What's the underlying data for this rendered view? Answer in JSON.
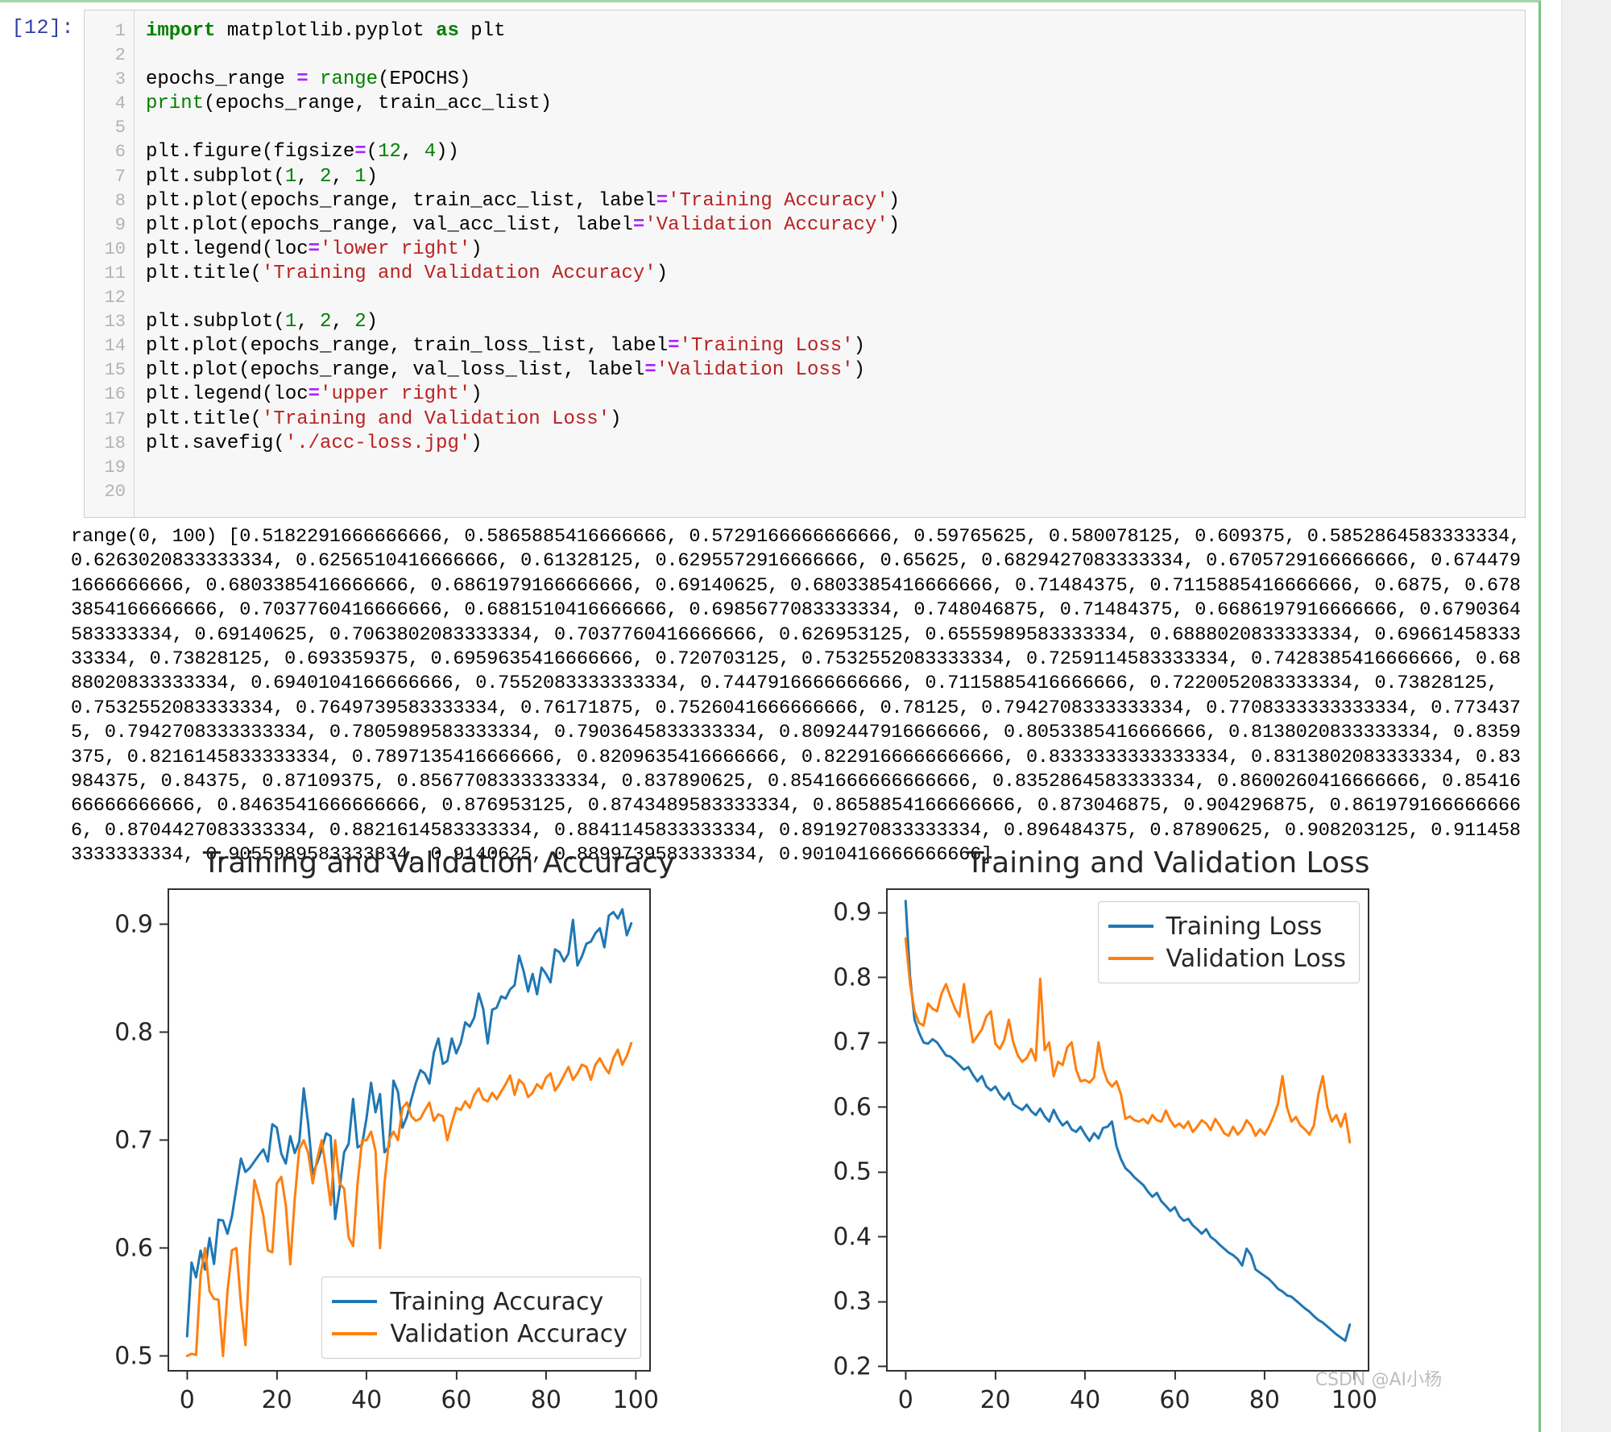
{
  "cell": {
    "prompt": "[12]:",
    "line_numbers": [
      "1",
      "2",
      "3",
      "4",
      "5",
      "6",
      "7",
      "8",
      "9",
      "10",
      "11",
      "12",
      "13",
      "14",
      "15",
      "16",
      "17",
      "18",
      "19",
      "20"
    ],
    "code_lines": [
      "import matplotlib.pyplot as plt",
      "",
      "epochs_range = range(EPOCHS)",
      "print(epochs_range, train_acc_list)",
      "",
      "plt.figure(figsize=(12, 4))",
      "plt.subplot(1, 2, 1)",
      "plt.plot(epochs_range, train_acc_list, label='Training Accuracy')",
      "plt.plot(epochs_range, val_acc_list, label='Validation Accuracy')",
      "plt.legend(loc='lower right')",
      "plt.title('Training and Validation Accuracy')",
      "",
      "plt.subplot(1, 2, 2)",
      "plt.plot(epochs_range, train_loss_list, label='Training Loss')",
      "plt.plot(epochs_range, val_loss_list, label='Validation Loss')",
      "plt.legend(loc='upper right')",
      "plt.title('Training and Validation Loss')",
      "plt.savefig('./acc-loss.jpg')",
      "",
      ""
    ]
  },
  "output": {
    "stdout": "range(0, 100) [0.5182291666666666, 0.5865885416666666, 0.5729166666666666, 0.59765625, 0.580078125, 0.609375, 0.5852864583333334, 0.6263020833333334, 0.6256510416666666, 0.61328125, 0.6295572916666666, 0.65625, 0.6829427083333334, 0.6705729166666666, 0.6744791666666666, 0.6803385416666666, 0.6861979166666666, 0.69140625, 0.6803385416666666, 0.71484375, 0.7115885416666666, 0.6875, 0.6783854166666666, 0.7037760416666666, 0.6881510416666666, 0.6985677083333334, 0.748046875, 0.71484375, 0.6686197916666666, 0.6790364583333334, 0.69140625, 0.7063802083333334, 0.7037760416666666, 0.626953125, 0.6555989583333334, 0.6888020833333334, 0.6966145833333334, 0.73828125, 0.693359375, 0.6959635416666666, 0.720703125, 0.7532552083333334, 0.7259114583333334, 0.7428385416666666, 0.6888020833333334, 0.6940104166666666, 0.7552083333333334, 0.7447916666666666, 0.7115885416666666, 0.7220052083333334, 0.73828125, 0.7532552083333334, 0.7649739583333334, 0.76171875, 0.7526041666666666, 0.78125, 0.7942708333333334, 0.7708333333333334, 0.7734375, 0.7942708333333334, 0.7805989583333334, 0.7903645833333334, 0.8092447916666666, 0.8053385416666666, 0.8138020833333334, 0.8359375, 0.8216145833333334, 0.7897135416666666, 0.8209635416666666, 0.8229166666666666, 0.8333333333333334, 0.8313802083333334, 0.83984375, 0.84375, 0.87109375, 0.8567708333333334, 0.837890625, 0.8541666666666666, 0.8352864583333334, 0.8600260416666666, 0.8541666666666666, 0.8463541666666666, 0.876953125, 0.8743489583333334, 0.8658854166666666, 0.873046875, 0.904296875, 0.8619791666666666, 0.8704427083333334, 0.8821614583333334, 0.8841145833333334, 0.8919270833333334, 0.896484375, 0.87890625, 0.908203125, 0.9114583333333334, 0.9055989583333334, 0.9140625, 0.8899739583333334, 0.9010416666666666]"
  },
  "watermark": "CSDN @AI小杨",
  "chart_data": [
    {
      "type": "line",
      "title": "Training and Validation Accuracy",
      "xlabel": "",
      "ylabel": "",
      "xlim": [
        -4,
        103
      ],
      "ylim": [
        0.487,
        0.932
      ],
      "xticks": [
        0,
        20,
        40,
        60,
        80,
        100
      ],
      "yticks": [
        0.5,
        0.6,
        0.7,
        0.8,
        0.9
      ],
      "grid": false,
      "legend_position": "lower right",
      "colors": {
        "training": "#1f77b4",
        "validation": "#ff7f0e"
      },
      "series": [
        {
          "name": "Training Accuracy",
          "color": "#1f77b4",
          "values": [
            0.5182291666666666,
            0.5865885416666666,
            0.5729166666666666,
            0.59765625,
            0.580078125,
            0.609375,
            0.5852864583333334,
            0.6263020833333334,
            0.6256510416666666,
            0.61328125,
            0.6295572916666666,
            0.65625,
            0.6829427083333334,
            0.6705729166666666,
            0.6744791666666666,
            0.6803385416666666,
            0.6861979166666666,
            0.69140625,
            0.6803385416666666,
            0.71484375,
            0.7115885416666666,
            0.6875,
            0.6783854166666666,
            0.7037760416666666,
            0.6881510416666666,
            0.6985677083333334,
            0.748046875,
            0.71484375,
            0.6686197916666666,
            0.6790364583333334,
            0.69140625,
            0.7063802083333334,
            0.7037760416666666,
            0.626953125,
            0.6555989583333334,
            0.6888020833333334,
            0.6966145833333334,
            0.73828125,
            0.693359375,
            0.6959635416666666,
            0.720703125,
            0.7532552083333334,
            0.7259114583333334,
            0.7428385416666666,
            0.6888020833333334,
            0.6940104166666666,
            0.7552083333333334,
            0.7447916666666666,
            0.7115885416666666,
            0.7220052083333334,
            0.73828125,
            0.7532552083333334,
            0.7649739583333334,
            0.76171875,
            0.7526041666666666,
            0.78125,
            0.7942708333333334,
            0.7708333333333334,
            0.7734375,
            0.7942708333333334,
            0.7805989583333334,
            0.7903645833333334,
            0.8092447916666666,
            0.8053385416666666,
            0.8138020833333334,
            0.8359375,
            0.8216145833333334,
            0.7897135416666666,
            0.8209635416666666,
            0.8229166666666666,
            0.8333333333333334,
            0.8313802083333334,
            0.83984375,
            0.84375,
            0.87109375,
            0.8567708333333334,
            0.837890625,
            0.8541666666666666,
            0.8352864583333334,
            0.8600260416666666,
            0.8541666666666666,
            0.8463541666666666,
            0.876953125,
            0.8743489583333334,
            0.8658854166666666,
            0.873046875,
            0.904296875,
            0.8619791666666666,
            0.8704427083333334,
            0.8821614583333334,
            0.8841145833333334,
            0.8919270833333334,
            0.896484375,
            0.87890625,
            0.908203125,
            0.9114583333333334,
            0.9055989583333334,
            0.9140625,
            0.8899739583333334,
            0.9010416666666666
          ]
        },
        {
          "name": "Validation Accuracy",
          "color": "#ff7f0e",
          "values": [
            0.5,
            0.502,
            0.501,
            0.575,
            0.6,
            0.56,
            0.553,
            0.552,
            0.5,
            0.56,
            0.598,
            0.6,
            0.548,
            0.51,
            0.6,
            0.663,
            0.648,
            0.63,
            0.598,
            0.596,
            0.66,
            0.666,
            0.64,
            0.585,
            0.646,
            0.692,
            0.7,
            0.688,
            0.66,
            0.683,
            0.7,
            0.672,
            0.64,
            0.7,
            0.66,
            0.655,
            0.61,
            0.602,
            0.66,
            0.7,
            0.7,
            0.708,
            0.69,
            0.6,
            0.66,
            0.7,
            0.708,
            0.7,
            0.73,
            0.735,
            0.722,
            0.718,
            0.72,
            0.728,
            0.735,
            0.718,
            0.724,
            0.722,
            0.7,
            0.716,
            0.73,
            0.728,
            0.736,
            0.73,
            0.742,
            0.748,
            0.738,
            0.736,
            0.744,
            0.738,
            0.745,
            0.752,
            0.76,
            0.742,
            0.756,
            0.752,
            0.74,
            0.744,
            0.752,
            0.748,
            0.758,
            0.762,
            0.746,
            0.752,
            0.76,
            0.768,
            0.756,
            0.762,
            0.77,
            0.768,
            0.756,
            0.77,
            0.776,
            0.768,
            0.762,
            0.776,
            0.784,
            0.77,
            0.778,
            0.79
          ]
        }
      ]
    },
    {
      "type": "line",
      "title": "Training and Validation Loss",
      "xlabel": "",
      "ylabel": "",
      "xlim": [
        -4,
        103
      ],
      "ylim": [
        0.195,
        0.935
      ],
      "xticks": [
        0,
        20,
        40,
        60,
        80,
        100
      ],
      "yticks": [
        0.2,
        0.3,
        0.4,
        0.5,
        0.6,
        0.7,
        0.8,
        0.9
      ],
      "grid": false,
      "legend_position": "upper right",
      "colors": {
        "training": "#1f77b4",
        "validation": "#ff7f0e"
      },
      "series": [
        {
          "name": "Training Loss",
          "color": "#1f77b4",
          "values": [
            0.918,
            0.8,
            0.735,
            0.715,
            0.7,
            0.698,
            0.705,
            0.7,
            0.69,
            0.68,
            0.678,
            0.672,
            0.665,
            0.658,
            0.662,
            0.65,
            0.64,
            0.648,
            0.632,
            0.626,
            0.632,
            0.62,
            0.612,
            0.622,
            0.605,
            0.6,
            0.596,
            0.604,
            0.594,
            0.588,
            0.598,
            0.586,
            0.578,
            0.596,
            0.582,
            0.572,
            0.578,
            0.566,
            0.562,
            0.57,
            0.558,
            0.548,
            0.56,
            0.552,
            0.568,
            0.57,
            0.578,
            0.54,
            0.52,
            0.506,
            0.5,
            0.492,
            0.486,
            0.48,
            0.47,
            0.462,
            0.468,
            0.455,
            0.448,
            0.44,
            0.446,
            0.432,
            0.425,
            0.428,
            0.418,
            0.412,
            0.405,
            0.412,
            0.4,
            0.395,
            0.388,
            0.382,
            0.376,
            0.372,
            0.366,
            0.356,
            0.382,
            0.372,
            0.35,
            0.345,
            0.34,
            0.335,
            0.328,
            0.32,
            0.316,
            0.31,
            0.308,
            0.302,
            0.296,
            0.29,
            0.285,
            0.278,
            0.272,
            0.268,
            0.262,
            0.256,
            0.25,
            0.245,
            0.24,
            0.265
          ]
        },
        {
          "name": "Validation Loss",
          "color": "#ff7f0e",
          "values": [
            0.86,
            0.79,
            0.748,
            0.73,
            0.726,
            0.76,
            0.752,
            0.748,
            0.775,
            0.79,
            0.77,
            0.752,
            0.74,
            0.79,
            0.742,
            0.7,
            0.71,
            0.72,
            0.74,
            0.748,
            0.698,
            0.69,
            0.704,
            0.735,
            0.7,
            0.68,
            0.67,
            0.676,
            0.69,
            0.672,
            0.798,
            0.688,
            0.7,
            0.648,
            0.67,
            0.665,
            0.692,
            0.7,
            0.658,
            0.64,
            0.642,
            0.638,
            0.646,
            0.7,
            0.66,
            0.64,
            0.632,
            0.64,
            0.62,
            0.582,
            0.586,
            0.58,
            0.578,
            0.582,
            0.575,
            0.588,
            0.58,
            0.578,
            0.595,
            0.58,
            0.57,
            0.575,
            0.568,
            0.578,
            0.562,
            0.57,
            0.58,
            0.575,
            0.565,
            0.582,
            0.572,
            0.56,
            0.556,
            0.57,
            0.558,
            0.565,
            0.58,
            0.572,
            0.556,
            0.566,
            0.558,
            0.57,
            0.586,
            0.605,
            0.648,
            0.6,
            0.578,
            0.585,
            0.572,
            0.566,
            0.558,
            0.572,
            0.62,
            0.648,
            0.6,
            0.578,
            0.588,
            0.57,
            0.59,
            0.546
          ]
        }
      ]
    }
  ]
}
